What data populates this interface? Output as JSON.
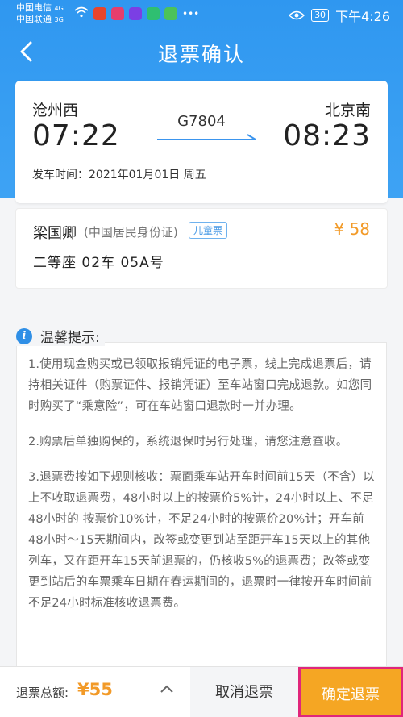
{
  "status_bar": {
    "carrier_1": "中国电信",
    "carrier_2": "中国联通",
    "net_1": "4G",
    "net_2": "3G",
    "battery": "30",
    "time": "下午4:26"
  },
  "nav": {
    "title": "退票确认",
    "back_icon": "chevron-left-icon"
  },
  "trip": {
    "from_station": "沧州西",
    "from_time": "07:22",
    "to_station": "北京南",
    "to_time": "08:23",
    "train_no": "G7804",
    "depart_label": "发车时间：",
    "depart_value": "2021年01月01日 周五"
  },
  "passenger": {
    "name": "梁国卿",
    "id_type": "(中国居民身份证)",
    "ticket_type": "儿童票",
    "price": "¥ 58",
    "seat": "二等座 02车 05A号"
  },
  "tips": {
    "title": "温馨提示:",
    "items": [
      "1.使用现金购买或已领取报销凭证的电子票，线上完成退票后，请持相关证件（购票证件、报销凭证）至车站窗口完成退款。如您同时购买了“乘意险”，可在车站窗口退款时一并办理。",
      "2.购票后单独购保的，系统退保时另行处理，请您注意查收。",
      "3.退票费按如下规则核收：票面乘车站开车时间前15天（不含）以上不收取退票费，48小时以上的按票价5%计，24小时以上、不足48小时的 按票价10%计，不足24小时的按票价20%计；开车前48小时～15天期间内，改签或变更到站至距开车15天以上的其他列车，又在距开车15天前退票的，仍核收5%的退票费；改签或变更到站后的车票乘车日期在春运期间的，退票时一律按开车时间前不足24小时标准核收退票费。"
    ]
  },
  "bottom": {
    "total_label": "退票总额:",
    "total_value": "¥55",
    "cancel_label": "取消退票",
    "confirm_label": "确定退票"
  },
  "colors": {
    "brand_blue": "#2f97f0",
    "price_orange": "#f29a28",
    "confirm_bg": "#f5a623",
    "confirm_border": "#e0267b"
  }
}
